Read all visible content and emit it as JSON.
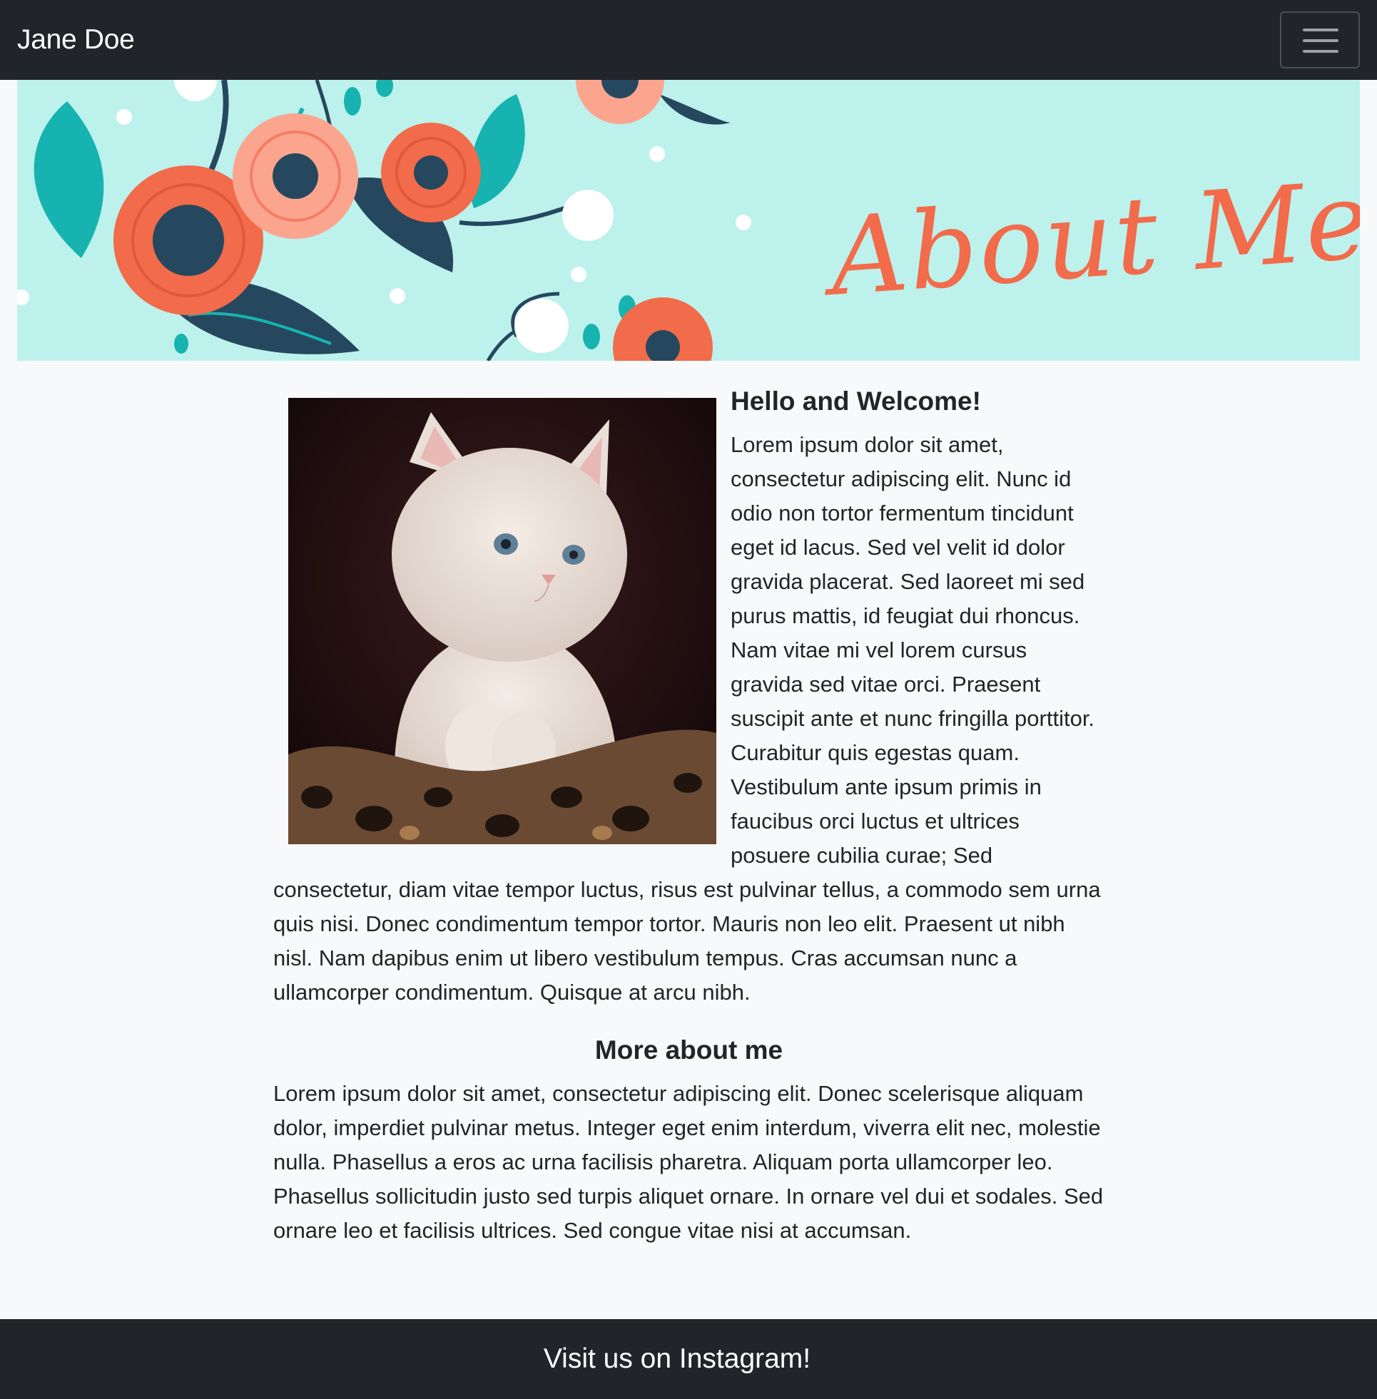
{
  "navbar": {
    "brand": "Jane Doe",
    "toggler_icon": "hamburger-menu-icon"
  },
  "banner": {
    "title": "About Me",
    "colors": {
      "background": "#bdf1ec",
      "flower": "#f26b4a",
      "leaf": "#16b3b0",
      "dark_leaf": "#26485e"
    }
  },
  "main": {
    "image_alt": "white kitten",
    "intro_heading": "Hello and Welcome!",
    "intro_text": "Lorem ipsum dolor sit amet, consectetur adipiscing elit. Nunc id odio non tortor fermentum tincidunt eget id lacus. Sed vel velit id dolor gravida placerat. Sed laoreet mi sed purus mattis, id feugiat dui rhoncus. Nam vitae mi vel lorem cursus gravida sed vitae orci. Praesent suscipit ante et nunc fringilla porttitor. Curabitur quis egestas quam. Vestibulum ante ipsum primis in faucibus orci luctus et ultrices posuere cubilia curae; Sed consectetur, diam vitae tempor luctus, risus est pulvinar tellus, a commodo sem urna quis nisi. Donec condimentum tempor tortor. Mauris non leo elit. Praesent ut nibh nisl. Nam dapibus enim ut libero vestibulum tempus. Cras accumsan nunc a ullamcorper condimentum. Quisque at arcu nibh.",
    "more_heading": "More about me",
    "more_text": "Lorem ipsum dolor sit amet, consectetur adipiscing elit. Donec scelerisque aliquam dolor, imperdiet pulvinar metus. Integer eget enim interdum, viverra elit nec, molestie nulla. Phasellus a eros ac urna facilisis pharetra. Aliquam porta ullamcorper leo. Phasellus sollicitudin justo sed turpis aliquet ornare. In ornare vel dui et sodales. Sed ornare leo et facilisis ultrices. Sed congue vitae nisi at accumsan."
  },
  "footer": {
    "link_text": "Visit us on Instagram!"
  }
}
